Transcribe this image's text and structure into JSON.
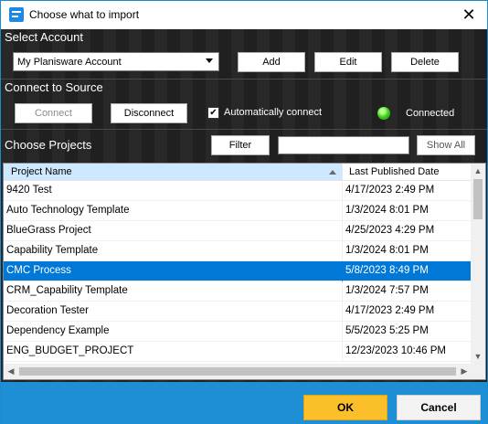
{
  "window": {
    "title": "Choose what to import",
    "close_glyph": "✕"
  },
  "account": {
    "section_title": "Select Account",
    "selected": "My Planisware Account",
    "add_label": "Add",
    "edit_label": "Edit",
    "delete_label": "Delete"
  },
  "source": {
    "section_title": "Connect to Source",
    "connect_label": "Connect",
    "disconnect_label": "Disconnect",
    "auto_connect_label": "Automatically connect",
    "auto_connect_checked": true,
    "check_glyph": "✔",
    "status_label": "Connected",
    "status_color": "#3fcf1a"
  },
  "projects": {
    "section_title": "Choose Projects",
    "filter_label": "Filter",
    "filter_value": "",
    "show_all_label": "Show All",
    "columns": [
      "Project Name",
      "Last Published Date"
    ],
    "rows": [
      {
        "name": "9420 Test",
        "date": "4/17/2023 2:49 PM"
      },
      {
        "name": "Auto Technology Template",
        "date": "1/3/2024 8:01 PM"
      },
      {
        "name": "BlueGrass Project",
        "date": "4/25/2023 4:29 PM"
      },
      {
        "name": "Capability Template",
        "date": "1/3/2024 8:01 PM"
      },
      {
        "name": "CMC Process",
        "date": "5/8/2023 8:49 PM"
      },
      {
        "name": "CRM_Capability Template",
        "date": "1/3/2024 7:57 PM"
      },
      {
        "name": "Decoration Tester",
        "date": "4/17/2023 2:49 PM"
      },
      {
        "name": "Dependency Example",
        "date": "5/5/2023 5:25 PM"
      },
      {
        "name": "ENG_BUDGET_PROJECT",
        "date": "12/23/2023 10:46 PM"
      }
    ],
    "selected_index": 4
  },
  "footer": {
    "ok_label": "OK",
    "cancel_label": "Cancel"
  },
  "colors": {
    "accent": "#1f8fd5",
    "selection": "#0078d7",
    "ok_button": "#fbbf2a"
  }
}
